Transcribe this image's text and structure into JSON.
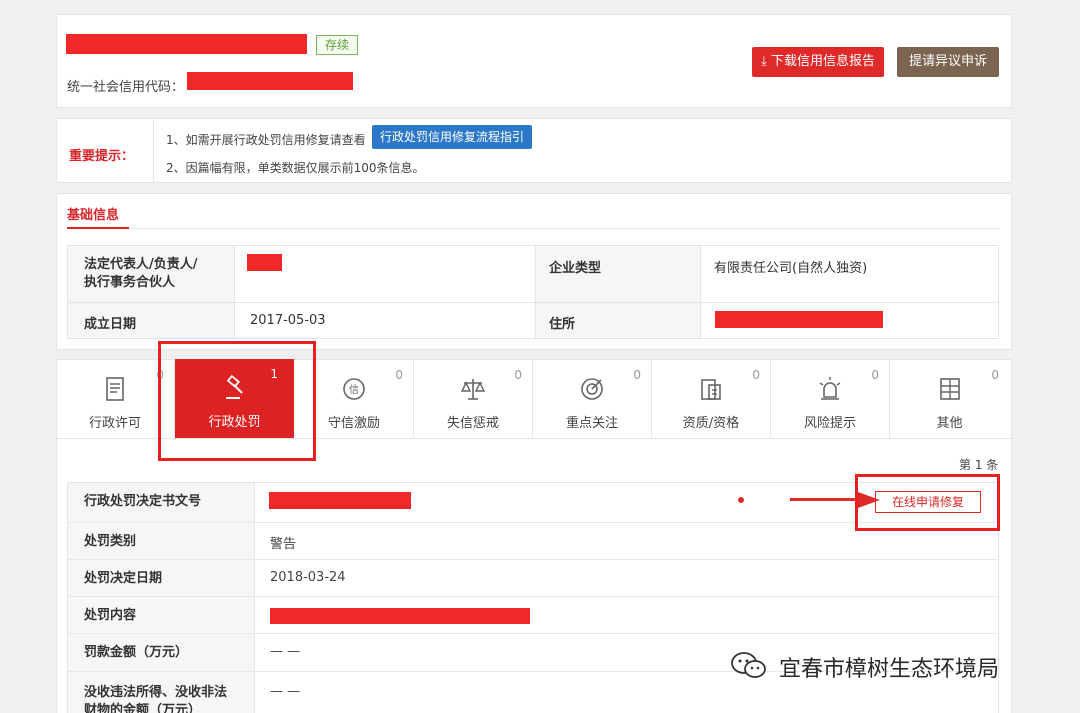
{
  "header": {
    "status_tag": "存续",
    "credit_code_label": "统一社会信用代码：",
    "download_button": "下载信用信息报告",
    "appeal_button": "提请异议申诉"
  },
  "notice": {
    "label": "重要提示：",
    "line1": "1、如需开展行政处罚信用修复请查看",
    "link": "行政处罚信用修复流程指引",
    "line2": "2、因篇幅有限，单类数据仅展示前100条信息。"
  },
  "basic_info": {
    "title": "基础信息",
    "legal_rep_label_1": "法定代表人/负责人/",
    "legal_rep_label_2": "执行事务合伙人",
    "enterprise_type_label": "企业类型",
    "enterprise_type_value": "有限责任公司(自然人独资)",
    "established_label": "成立日期",
    "established_value": "2017-05-03",
    "address_label": "住所"
  },
  "tabs": [
    {
      "label": "行政许可",
      "count": "0",
      "icon": "document-icon"
    },
    {
      "label": "行政处罚",
      "count": "1",
      "icon": "gavel-icon"
    },
    {
      "label": "守信激励",
      "count": "0",
      "icon": "credit-medal-icon"
    },
    {
      "label": "失信惩戒",
      "count": "0",
      "icon": "scales-icon"
    },
    {
      "label": "重点关注",
      "count": "0",
      "icon": "target-icon"
    },
    {
      "label": "资质/资格",
      "count": "0",
      "icon": "certificate-icon"
    },
    {
      "label": "风险提示",
      "count": "0",
      "icon": "alarm-icon"
    },
    {
      "label": "其他",
      "count": "0",
      "icon": "grid-icon"
    }
  ],
  "penalty": {
    "page_count": "第 1 条",
    "repair_button": "在线申请修复",
    "rows": [
      {
        "label": "行政处罚决定书文号",
        "value": ""
      },
      {
        "label": "处罚类别",
        "value": "警告"
      },
      {
        "label": "处罚决定日期",
        "value": "2018-03-24"
      },
      {
        "label": "处罚内容",
        "value": ""
      },
      {
        "label": "罚款金额（万元）",
        "value": "— —"
      },
      {
        "label_1": "没收违法所得、没收非法",
        "label_2": "财物的金额（万元）",
        "value": "— —"
      }
    ]
  },
  "watermark": {
    "account": "宜春市樟树生态环境局"
  }
}
